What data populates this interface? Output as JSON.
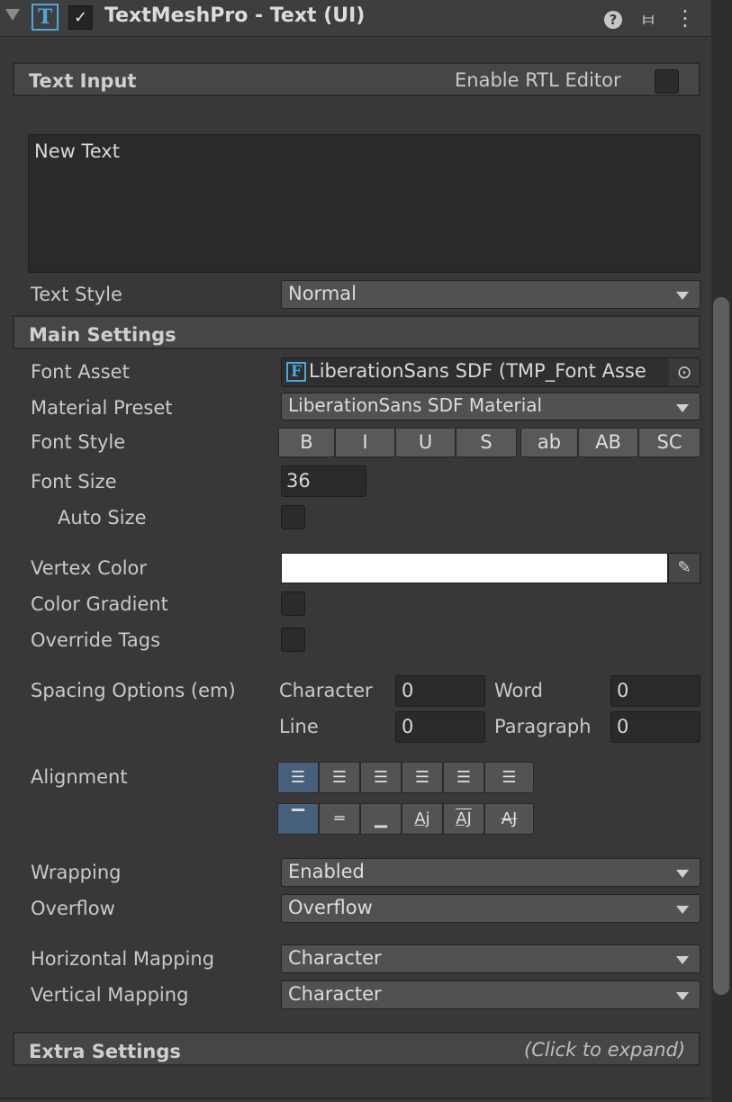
{
  "header": {
    "title": "TextMeshPro - Text (UI)",
    "t_icon_glyph": "T",
    "check_glyph": "✓",
    "icons": [
      "help-icon",
      "preset-sliders-icon",
      "more-options-icon"
    ],
    "help_glyph": "?",
    "preset_glyph": "⧦",
    "more_glyph": "⋮"
  },
  "text_input": {
    "title": "Text Input",
    "rtl_label": "Enable RTL Editor",
    "text": "New Text"
  },
  "text_style": {
    "label": "Text Style",
    "value": "Normal"
  },
  "main_settings": {
    "title": "Main Settings",
    "font_asset_label": "Font Asset",
    "font_asset_glyph": "F",
    "font_asset_value": "LiberationSans SDF (TMP_Font Asse",
    "object_picker_glyph": "⊙",
    "material_preset_label": "Material Preset",
    "material_preset_value": "LiberationSans SDF Material",
    "font_style_label": "Font Style",
    "font_style_buttons": [
      "B",
      "I",
      "U",
      "S",
      "ab",
      "AB",
      "SC"
    ],
    "font_size_label": "Font Size",
    "font_size_value": "36",
    "auto_size_label": "Auto Size",
    "vertex_color_label": "Vertex Color",
    "vertex_color": "#ffffff",
    "eyedropper_glyph": "✎",
    "color_gradient_label": "Color Gradient",
    "override_tags_label": "Override Tags",
    "spacing_label": "Spacing Options (em)",
    "character_label": "Character",
    "character_value": "0",
    "word_label": "Word",
    "word_value": "0",
    "line_label": "Line",
    "line_value": "0",
    "paragraph_label": "Paragraph",
    "paragraph_value": "0",
    "alignment_label": "Alignment",
    "horizontal_align_glyphs": [
      "☰",
      "☰",
      "☰",
      "☰",
      "☰",
      "☰"
    ],
    "vertical_align_glyphs": [
      "▔",
      "═",
      "▁",
      "Aj",
      "AJ",
      "AJ"
    ],
    "wrapping_label": "Wrapping",
    "wrapping_value": "Enabled",
    "overflow_label": "Overflow",
    "overflow_value": "Overflow",
    "horizontal_mapping_label": "Horizontal Mapping",
    "horizontal_mapping_value": "Character",
    "vertical_mapping_label": "Vertical Mapping",
    "vertical_mapping_value": "Character"
  },
  "extra_settings": {
    "title": "Extra Settings",
    "hint": "(Click to expand)"
  },
  "colors": {
    "background": "#383838",
    "accent_blue": "#4aa8e0",
    "active_button": "#46607c"
  }
}
